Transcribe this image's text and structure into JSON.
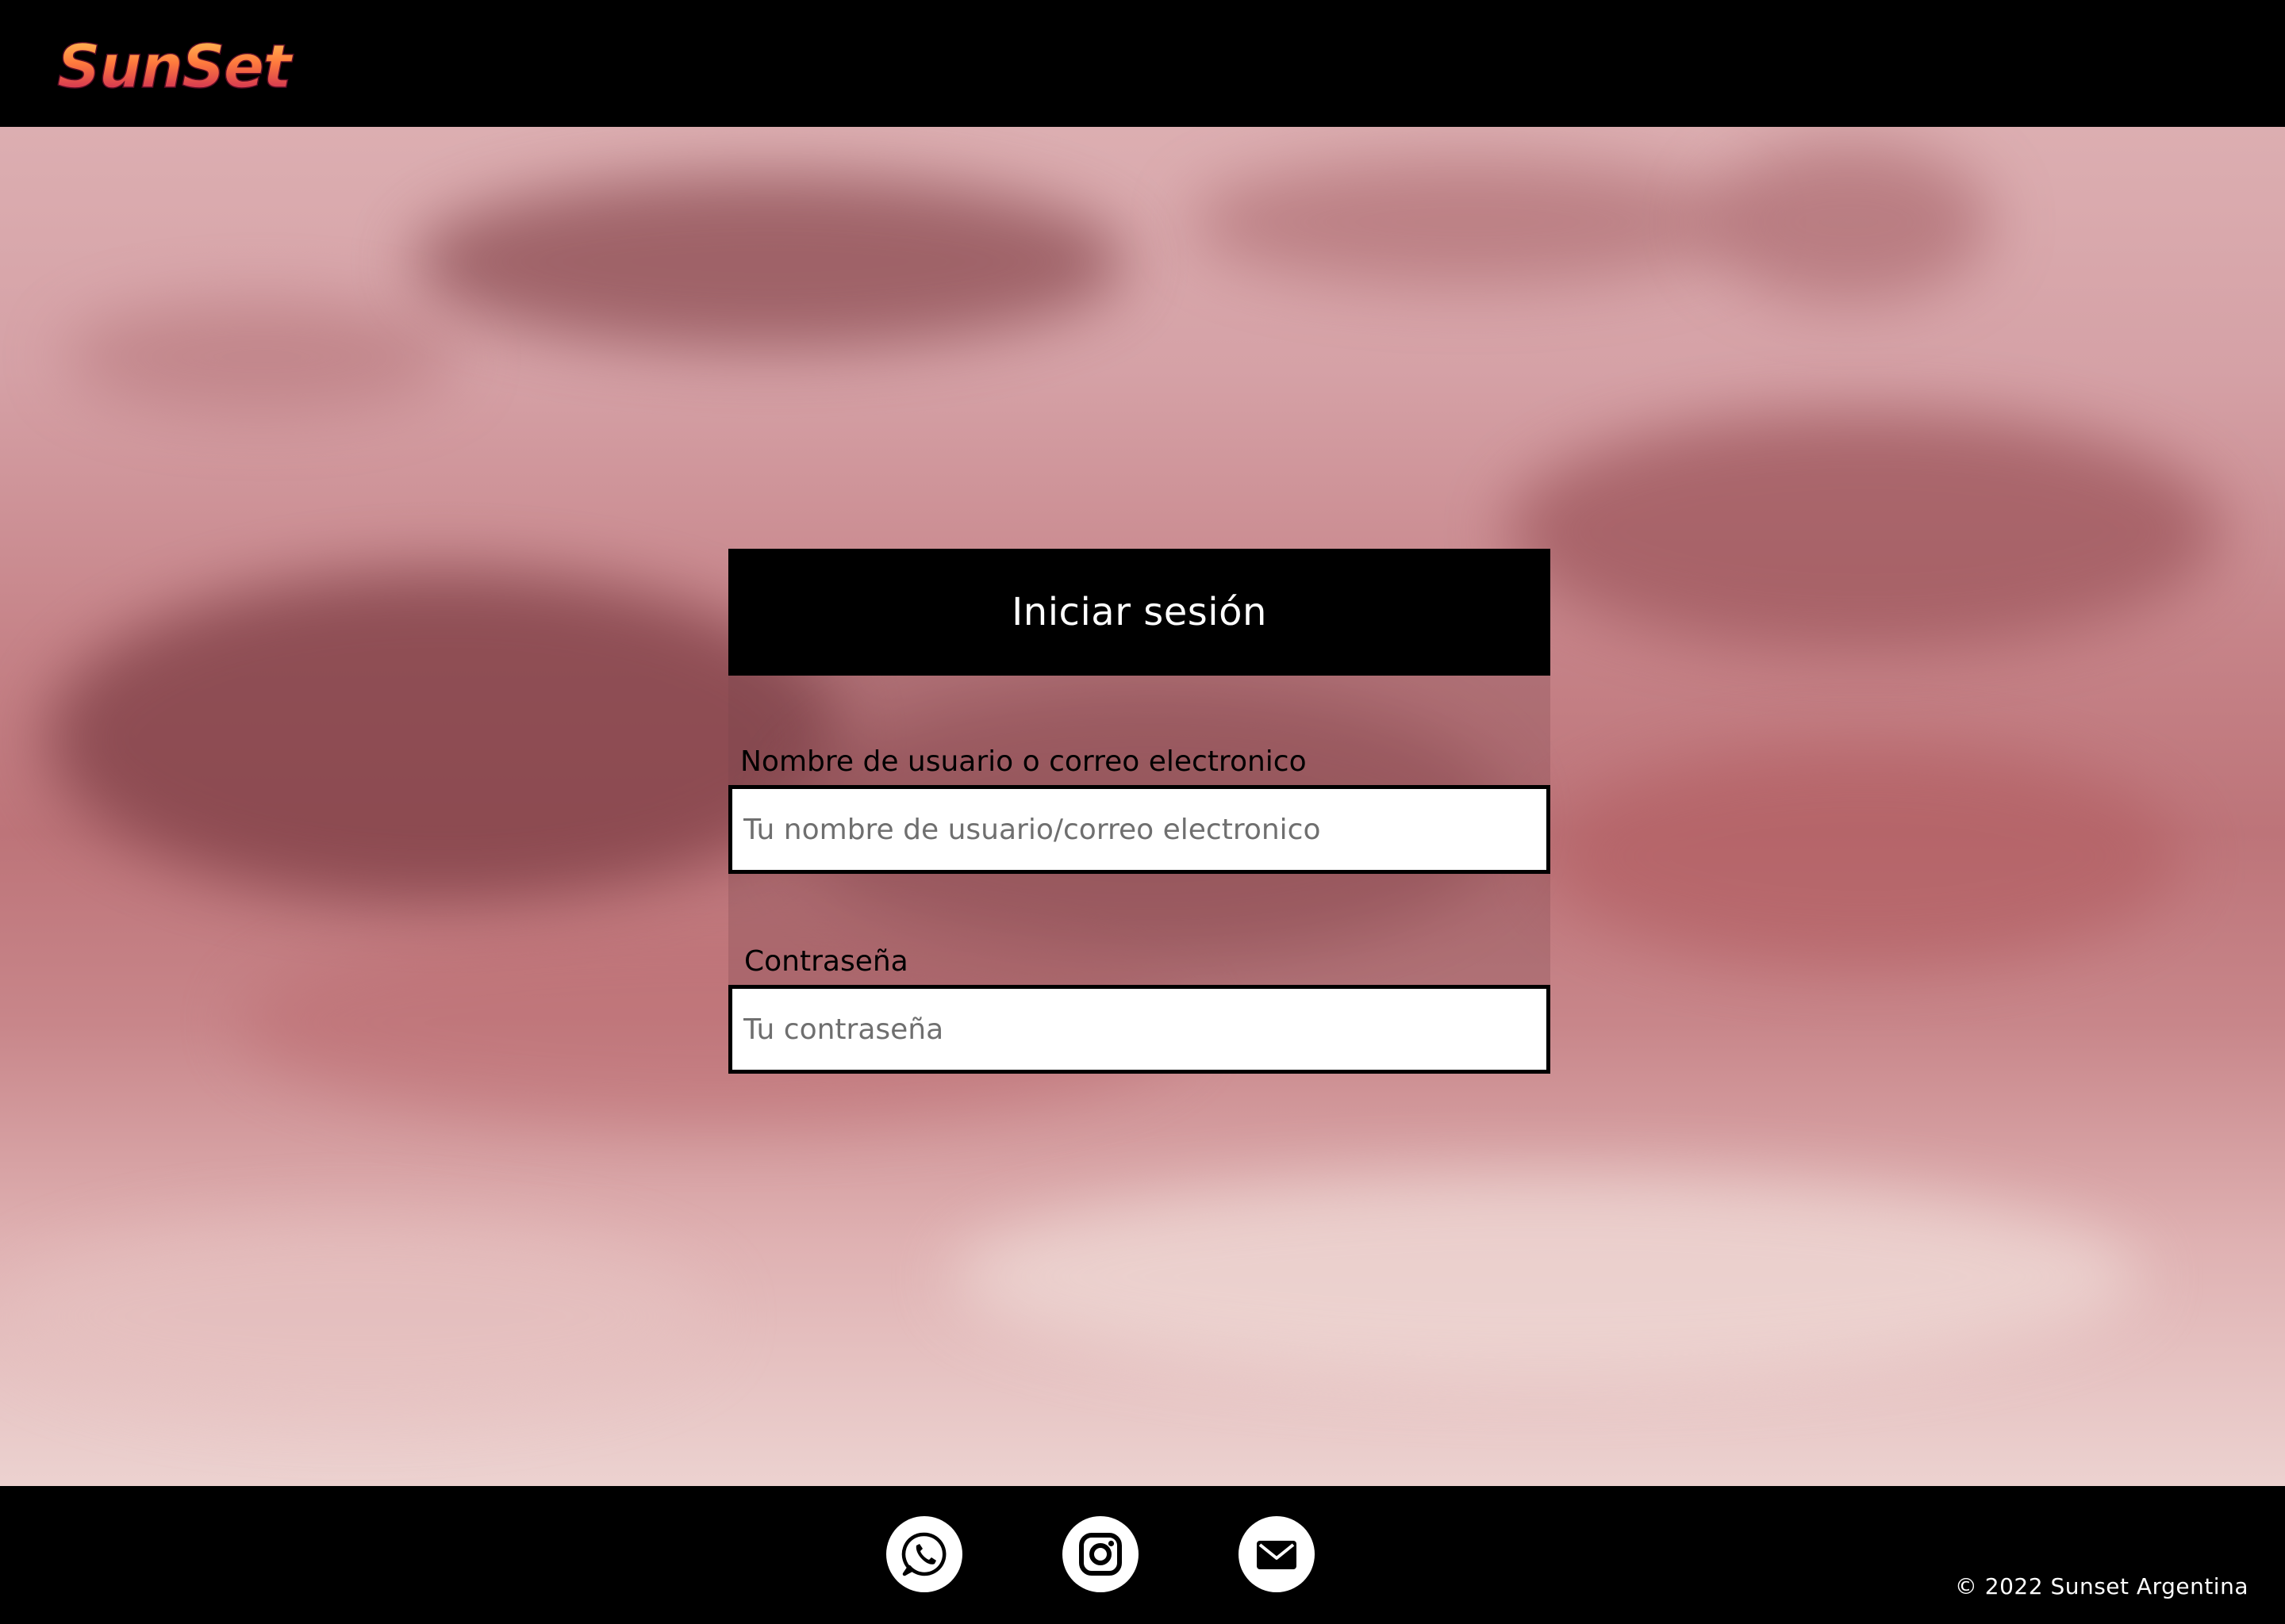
{
  "header": {
    "logo_text": "SunSet"
  },
  "login": {
    "title": "Iniciar sesión",
    "username_label": "Nombre de usuario o correo electronico",
    "username_placeholder": "Tu nombre de usuario/correo electronico",
    "username_value": "",
    "password_label": "Contraseña",
    "password_placeholder": "Tu contraseña",
    "password_value": ""
  },
  "footer": {
    "social_icons": [
      "whatsapp-icon",
      "instagram-icon",
      "mail-icon"
    ],
    "copyright": "© 2022 Sunset Argentina"
  },
  "colors": {
    "header_bg": "#000000",
    "footer_bg": "#000000",
    "logo_gradient_top": "#ffb347",
    "logo_gradient_bottom": "#c2185b"
  }
}
